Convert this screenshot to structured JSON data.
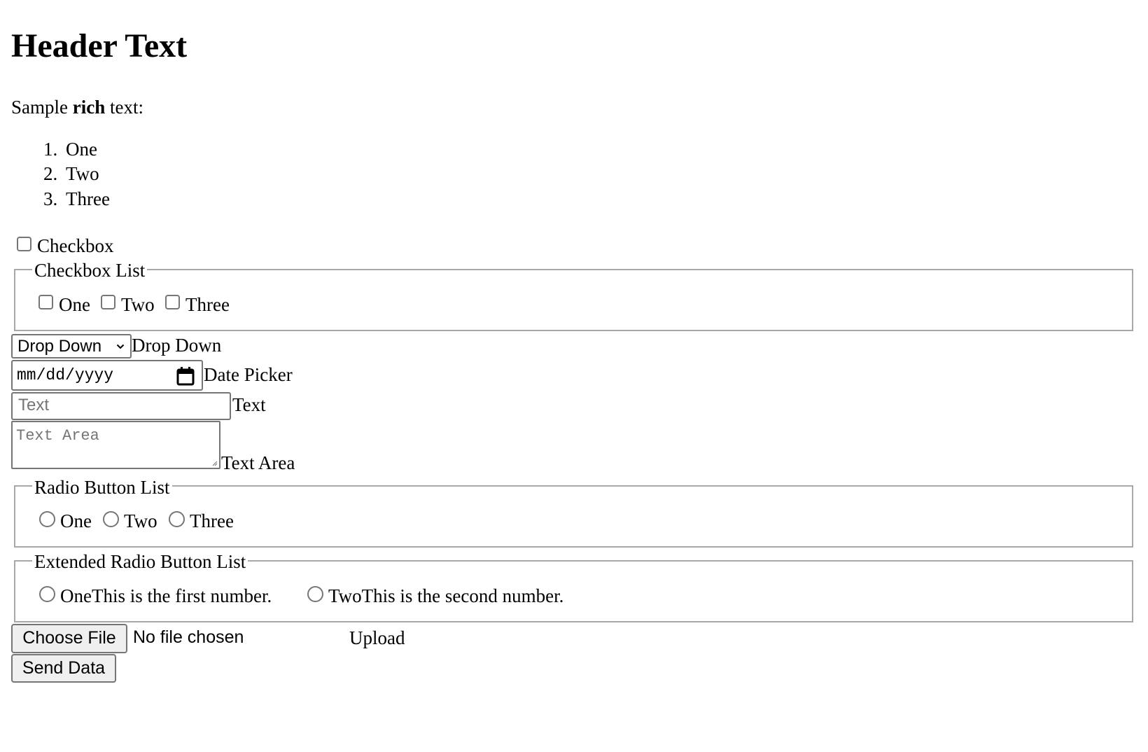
{
  "header": {
    "title": "Header Text"
  },
  "rich_text": {
    "prefix": "Sample ",
    "bold": "rich",
    "suffix": " text:"
  },
  "ordered_list": [
    {
      "num": "1.",
      "label": "One"
    },
    {
      "num": "2.",
      "label": "Two"
    },
    {
      "num": "3.",
      "label": "Three"
    }
  ],
  "checkbox": {
    "label": "Checkbox",
    "checked": false
  },
  "checkbox_list": {
    "legend": "Checkbox List",
    "items": [
      {
        "label": "One",
        "checked": false
      },
      {
        "label": "Two",
        "checked": false
      },
      {
        "label": "Three",
        "checked": false
      }
    ]
  },
  "dropdown": {
    "selected": "Drop Down",
    "label": "Drop Down",
    "icon": "chevron-down-icon"
  },
  "date_picker": {
    "placeholder": "mm/dd/yyyy",
    "label": "Date Picker",
    "icon": "calendar-icon"
  },
  "text_input": {
    "placeholder": "Text",
    "value": "",
    "label": "Text"
  },
  "text_area": {
    "placeholder": "Text Area",
    "value": "",
    "label": "Text Area"
  },
  "radio_list": {
    "legend": "Radio Button List",
    "items": [
      {
        "label": "One",
        "selected": false
      },
      {
        "label": "Two",
        "selected": false
      },
      {
        "label": "Three",
        "selected": false
      }
    ]
  },
  "extended_radio_list": {
    "legend": "Extended Radio Button List",
    "items": [
      {
        "label": "One",
        "description": "This is the first number.",
        "selected": false
      },
      {
        "label": "Two",
        "description": "This is the second number.",
        "selected": false
      }
    ]
  },
  "file_upload": {
    "button_label": "Choose File",
    "status": "No file chosen",
    "label": "Upload"
  },
  "submit": {
    "label": "Send Data"
  }
}
